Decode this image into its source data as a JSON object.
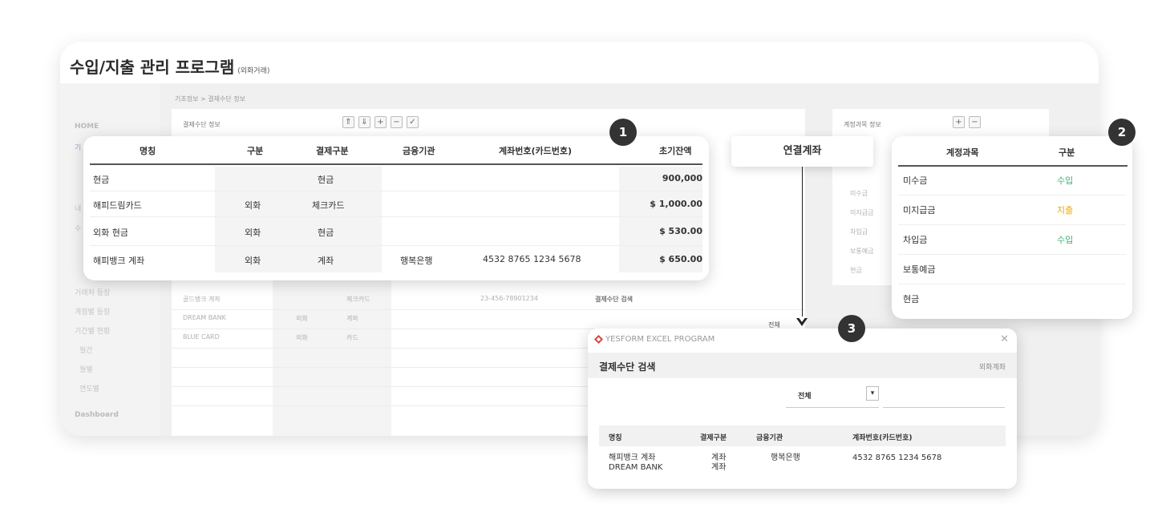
{
  "app": {
    "title": "수입/지출 관리 프로그램",
    "subtitle": "(외화거래)",
    "breadcrumb": "기초정보 > 결제수단 정보",
    "bg_panel_title": "결제수단 정보",
    "bg_right_panel_title": "계정과목 정보",
    "bg_search_title": "결제수단 검색",
    "bg_filter_value": "전체"
  },
  "sidebar": {
    "items": [
      "HOME",
      "기",
      "내",
      "수",
      "거래처 등장",
      "계정별 등장",
      "기간별 현황",
      "월간",
      "월별",
      "연도별",
      "Dashboard"
    ]
  },
  "bg_rows": [
    {
      "name": "골드뱅크 계좌",
      "type": "제크카드",
      "number": "23-456-78901234"
    },
    {
      "name": "DREAM BANK",
      "cur": "외화",
      "type": "계좌"
    },
    {
      "name": "BLUE CARD",
      "cur": "외화",
      "type": "카드"
    }
  ],
  "bg_right_rows": [
    "미수금",
    "미지급금",
    "차입금",
    "보통예금",
    "현금"
  ],
  "toolbar_icons": [
    "arrow-up-icon",
    "arrow-down-icon",
    "plus-icon",
    "minus-icon",
    "check-icon"
  ],
  "payment_table": {
    "badge": "1",
    "headers": [
      "명칭",
      "구분",
      "결제구분",
      "금융기관",
      "계좌번호(카드번호)",
      "초기잔액"
    ],
    "rows": [
      {
        "name": "현금",
        "cur": "",
        "type": "현금",
        "bank": "",
        "number": "",
        "balance": "900,000"
      },
      {
        "name": "해피드림카드",
        "cur": "외화",
        "type": "체크카드",
        "bank": "",
        "number": "",
        "balance": "$ 1,000.00"
      },
      {
        "name": "외화 현금",
        "cur": "외화",
        "type": "현금",
        "bank": "",
        "number": "",
        "balance": "$ 530.00"
      },
      {
        "name": "해피뱅크 계좌",
        "cur": "외화",
        "type": "계좌",
        "bank": "행복은행",
        "number": "4532 8765 1234 5678",
        "balance": "$ 650.00"
      }
    ]
  },
  "linked_account": {
    "label": "연결계좌"
  },
  "account_table": {
    "badge": "2",
    "headers": [
      "계정과목",
      "구분"
    ],
    "rows": [
      {
        "name": "미수금",
        "type": "수입",
        "color": "#3cb371"
      },
      {
        "name": "미지급금",
        "type": "지출",
        "color": "#f2a900"
      },
      {
        "name": "차입금",
        "type": "수입",
        "color": "#3cb371"
      },
      {
        "name": "보통예금",
        "type": "",
        "color": "#333333"
      },
      {
        "name": "현금",
        "type": "",
        "color": "#333333"
      }
    ]
  },
  "dialog": {
    "badge": "3",
    "window_title": "YESFORM EXCEL PROGRAM",
    "heading": "결제수단 검색",
    "heading_right": "외화계좌",
    "filter_label": "전체",
    "filter_arrow": "▾",
    "close": "✕",
    "headers": [
      "명칭",
      "결제구분",
      "금융기관",
      "계좌번호(카드번호)"
    ],
    "rows": [
      {
        "name": "해피뱅크 계좌",
        "type": "계좌",
        "bank": "행복은행",
        "number": "4532 8765 1234 5678"
      },
      {
        "name": "DREAM BANK",
        "type": "계좌",
        "bank": "",
        "number": ""
      }
    ]
  },
  "colors": {
    "income": "#3cb371",
    "expense": "#f2a900",
    "badge": "#333333",
    "logo": "#d9433b"
  }
}
